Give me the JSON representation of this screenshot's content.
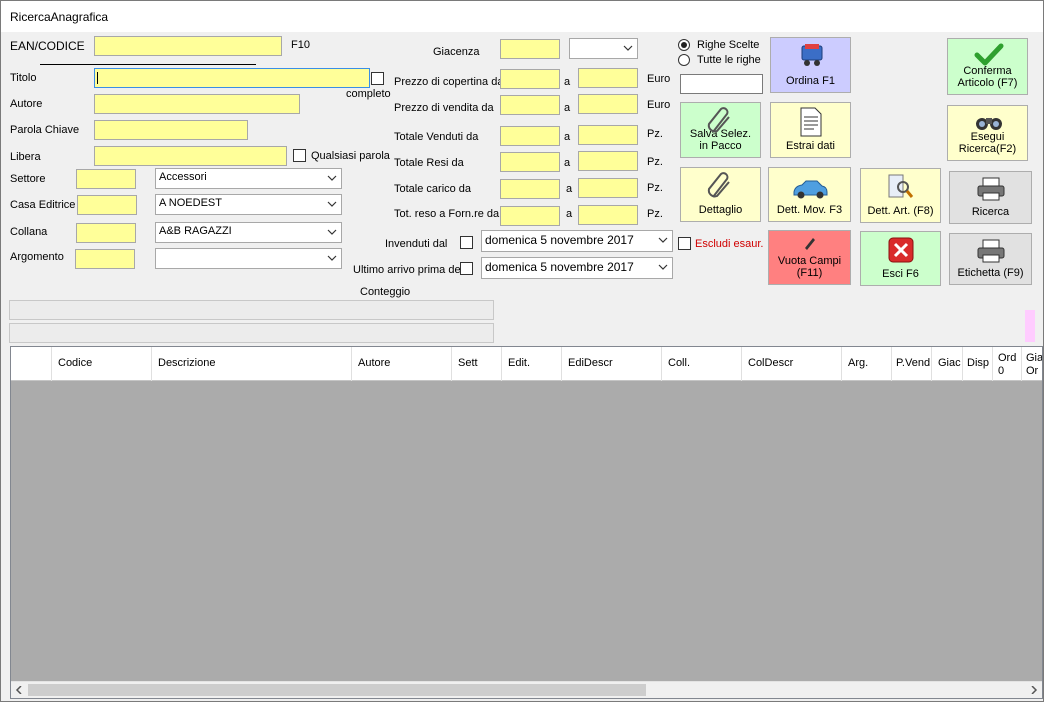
{
  "window": {
    "title": "RicercaAnagrafica"
  },
  "left": {
    "ean_label": "EAN/CODICE",
    "ean_key": "F10",
    "titolo_label": "Titolo",
    "completo_label": "completo",
    "autore_label": "Autore",
    "parola_chiave_label": "Parola Chiave",
    "libera_label": "Libera",
    "qualsiasi_label": "Qualsiasi parola",
    "settore_label": "Settore",
    "settore_value": "Accessori",
    "casa_label": "Casa Editrice",
    "casa_value": "A NOEDEST",
    "collana_label": "Collana",
    "collana_value": "A&B  RAGAZZI",
    "argomento_label": "Argomento",
    "argomento_value": ""
  },
  "middle": {
    "giacenza_label": "Giacenza",
    "prezzo_copertina_label": "Prezzo di copertina da",
    "prezzo_vendita_label": "Prezzo di vendita da",
    "venduti_label": "Totale Venduti da",
    "resi_label": "Totale Resi da",
    "carico_label": "Totale carico da",
    "reso_forn_label": "Tot. reso a Forn.re da",
    "a_label": "a",
    "euro_label": "Euro",
    "pz_label": "Pz.",
    "invenduti_label": "Invenduti dal",
    "invenduti_date": "domenica    5 novembre 2017",
    "ultimo_label": "Ultimo arrivo prima del",
    "ultimo_date": "domenica    5 novembre 2017",
    "escludi_label": "Escludi  esaur.",
    "conteggio_label": "Conteggio"
  },
  "options": {
    "righe_scelte": "Righe Scelte",
    "tutte_righe": "Tutte le righe"
  },
  "buttons": {
    "ordina": "Ordina F1",
    "conferma_1": "Conferma",
    "conferma_2": "Articolo (F7)",
    "salva_1": "Salva Selez.",
    "salva_2": "in Pacco",
    "estrai": "Estrai dati",
    "esegui_1": "Esegui",
    "esegui_2": "Ricerca(F2)",
    "dettaglio": "Dettaglio",
    "dett_mov": "Dett. Mov. F3",
    "dett_art": "Dett. Art. (F8)",
    "ricerca": "Ricerca",
    "vuota_1": "Vuota Campi",
    "vuota_2": "(F11)",
    "esci": "Esci F6",
    "etichetta": "Etichetta (F9)"
  },
  "grid": {
    "columns": [
      "",
      "Codice",
      "Descrizione",
      "Autore",
      "Sett",
      "Edit.",
      "EdiDescr",
      "Coll.",
      "ColDescr",
      "Arg.",
      "P.Vend",
      "Giac",
      "Disp",
      "Ord 0",
      "Gia Or"
    ]
  },
  "colors": {
    "field_yellow": "#ffff99",
    "green_button": "#ccffcc",
    "blue_button": "#ccccff",
    "red_button": "#ff8080",
    "light_yellow_button": "#ffffcc"
  }
}
